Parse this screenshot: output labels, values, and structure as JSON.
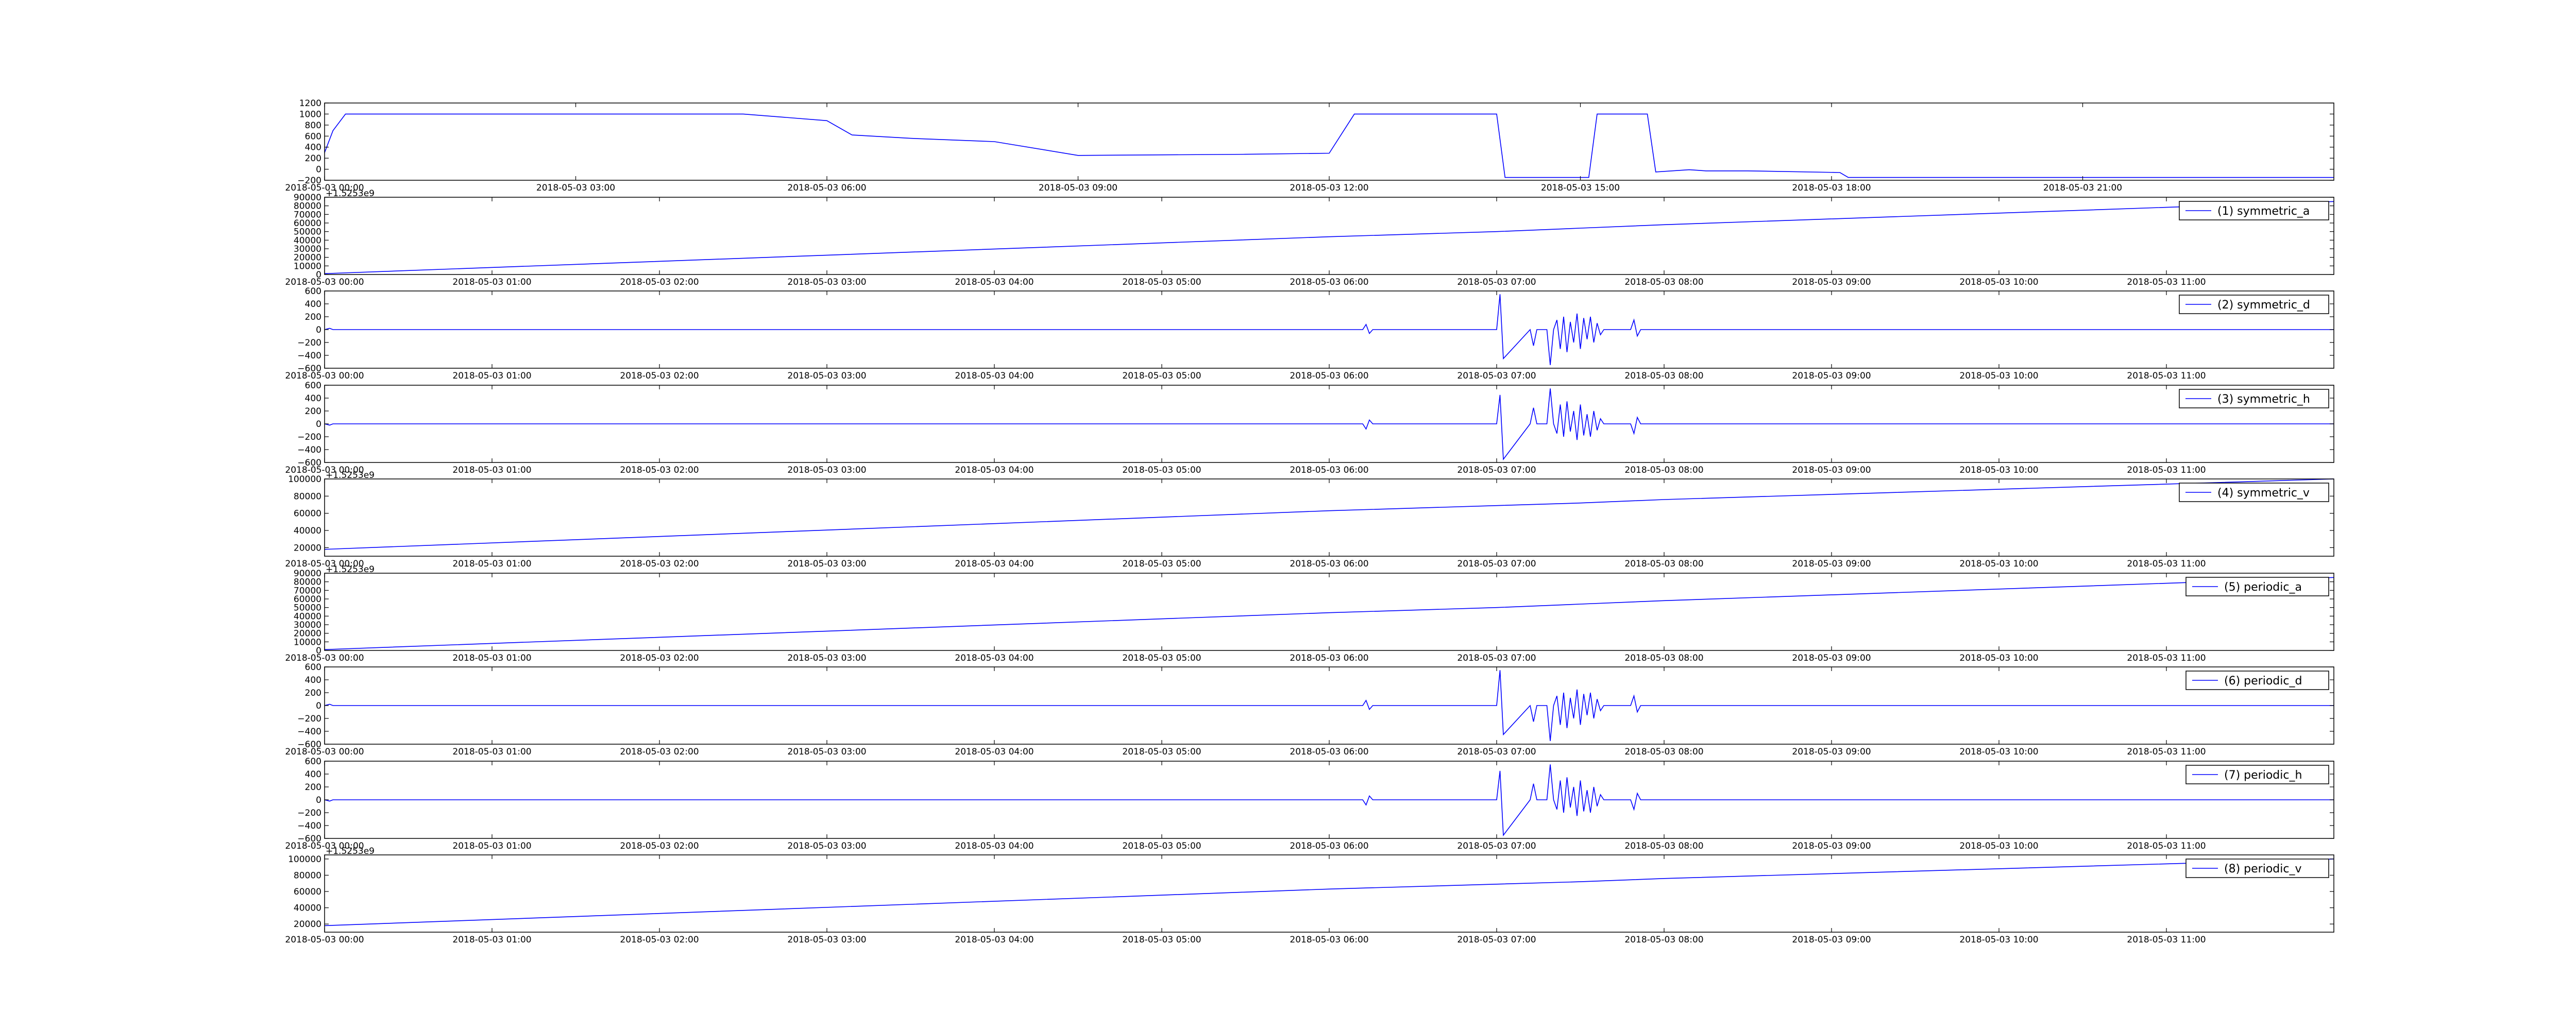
{
  "chart_data": [
    {
      "type": "line",
      "legend": "",
      "offset_text": "",
      "color": "#0000ff",
      "ylim": [
        -200,
        1200
      ],
      "yticks": [
        -200,
        0,
        200,
        400,
        600,
        800,
        1000,
        1200
      ],
      "xlim": [
        0,
        24
      ],
      "xticks": [
        0,
        3,
        6,
        9,
        12,
        15,
        18,
        21
      ],
      "xtick_labels": [
        "2018-05-03 00:00",
        "2018-05-03 03:00",
        "2018-05-03 06:00",
        "2018-05-03 09:00",
        "2018-05-03 12:00",
        "2018-05-03 15:00",
        "2018-05-03 18:00",
        "2018-05-03 21:00"
      ],
      "x": [
        0,
        0.1,
        0.25,
        3,
        5.0,
        6.0,
        6.3,
        7,
        8,
        9,
        10,
        11,
        12,
        12.3,
        13.4,
        14.0,
        14.1,
        15.1,
        15.2,
        15.8,
        15.9,
        16.3,
        16.5,
        17,
        18.1,
        18.2,
        24
      ],
      "values": [
        300,
        700,
        1000,
        1000,
        1000,
        880,
        620,
        560,
        500,
        250,
        260,
        270,
        290,
        1000,
        1000,
        1000,
        -150,
        -150,
        1000,
        1000,
        -50,
        -10,
        -30,
        -30,
        -60,
        -150,
        -150
      ]
    },
    {
      "type": "line",
      "legend": "(1) symmetric_a",
      "offset_text": "+1.5253e9",
      "color": "#0000ff",
      "ylim": [
        0,
        90000
      ],
      "yticks": [
        0,
        10000,
        20000,
        30000,
        40000,
        50000,
        60000,
        70000,
        80000,
        90000
      ],
      "xlim": [
        0,
        12
      ],
      "xticks": [
        0,
        1,
        2,
        3,
        4,
        5,
        6,
        7,
        8,
        9,
        10,
        11
      ],
      "xtick_labels": [
        "2018-05-03 00:00",
        "2018-05-03 01:00",
        "2018-05-03 02:00",
        "2018-05-03 03:00",
        "2018-05-03 04:00",
        "2018-05-03 05:00",
        "2018-05-03 06:00",
        "2018-05-03 07:00",
        "2018-05-03 08:00",
        "2018-05-03 09:00",
        "2018-05-03 10:00",
        "2018-05-03 11:00"
      ],
      "x": [
        0,
        6,
        7,
        7.5,
        8,
        12
      ],
      "values": [
        1000,
        44000,
        50000,
        54000,
        58000,
        85000
      ]
    },
    {
      "type": "line",
      "legend": "(2) symmetric_d",
      "offset_text": "",
      "color": "#0000ff",
      "ylim": [
        -600,
        600
      ],
      "yticks": [
        -600,
        -400,
        -200,
        0,
        200,
        400,
        600
      ],
      "xlim": [
        0,
        12
      ],
      "xticks": [
        0,
        1,
        2,
        3,
        4,
        5,
        6,
        7,
        8,
        9,
        10,
        11
      ],
      "xtick_labels": [
        "2018-05-03 00:00",
        "2018-05-03 01:00",
        "2018-05-03 02:00",
        "2018-05-03 03:00",
        "2018-05-03 04:00",
        "2018-05-03 05:00",
        "2018-05-03 06:00",
        "2018-05-03 07:00",
        "2018-05-03 08:00",
        "2018-05-03 09:00",
        "2018-05-03 10:00",
        "2018-05-03 11:00"
      ],
      "x": [
        0,
        0.03,
        0.05,
        5.8,
        6.2,
        6.22,
        6.24,
        6.26,
        7.0,
        7.02,
        7.04,
        7.2,
        7.22,
        7.24,
        7.26,
        7.3,
        7.32,
        7.34,
        7.36,
        7.38,
        7.4,
        7.42,
        7.44,
        7.46,
        7.48,
        7.5,
        7.52,
        7.54,
        7.56,
        7.58,
        7.6,
        7.62,
        7.64,
        7.8,
        7.82,
        7.84,
        7.86,
        8.1,
        12
      ],
      "values": [
        0,
        20,
        0,
        0,
        0,
        80,
        -60,
        0,
        0,
        550,
        -450,
        0,
        -250,
        0,
        0,
        0,
        -550,
        0,
        150,
        -300,
        200,
        -350,
        120,
        -200,
        250,
        -300,
        180,
        -150,
        200,
        -200,
        100,
        -80,
        0,
        0,
        150,
        -100,
        0,
        0,
        0
      ]
    },
    {
      "type": "line",
      "legend": "(3) symmetric_h",
      "offset_text": "",
      "color": "#0000ff",
      "ylim": [
        -600,
        600
      ],
      "yticks": [
        -600,
        -400,
        -200,
        0,
        200,
        400,
        600
      ],
      "xlim": [
        0,
        12
      ],
      "xticks": [
        0,
        1,
        2,
        3,
        4,
        5,
        6,
        7,
        8,
        9,
        10,
        11
      ],
      "xtick_labels": [
        "2018-05-03 00:00",
        "2018-05-03 01:00",
        "2018-05-03 02:00",
        "2018-05-03 03:00",
        "2018-05-03 04:00",
        "2018-05-03 05:00",
        "2018-05-03 06:00",
        "2018-05-03 07:00",
        "2018-05-03 08:00",
        "2018-05-03 09:00",
        "2018-05-03 10:00",
        "2018-05-03 11:00"
      ],
      "x": [
        0,
        0.03,
        0.05,
        5.8,
        6.2,
        6.22,
        6.24,
        6.26,
        7.0,
        7.02,
        7.04,
        7.2,
        7.22,
        7.24,
        7.26,
        7.3,
        7.32,
        7.34,
        7.36,
        7.38,
        7.4,
        7.42,
        7.44,
        7.46,
        7.48,
        7.5,
        7.52,
        7.54,
        7.56,
        7.58,
        7.6,
        7.62,
        7.64,
        7.8,
        7.82,
        7.84,
        7.86,
        8.1,
        12
      ],
      "values": [
        0,
        -20,
        0,
        0,
        0,
        -80,
        60,
        0,
        0,
        450,
        -550,
        0,
        250,
        0,
        0,
        0,
        550,
        0,
        -150,
        300,
        -200,
        350,
        -120,
        200,
        -250,
        300,
        -180,
        150,
        -200,
        200,
        -100,
        80,
        0,
        0,
        -150,
        100,
        0,
        0,
        0
      ]
    },
    {
      "type": "line",
      "legend": "(4) symmetric_v",
      "offset_text": "+1.5253e9",
      "color": "#0000ff",
      "ylim": [
        10000,
        100000
      ],
      "yticks": [
        20000,
        40000,
        60000,
        80000,
        100000
      ],
      "xlim": [
        0,
        12
      ],
      "xticks": [
        0,
        1,
        2,
        3,
        4,
        5,
        6,
        7,
        8,
        9,
        10,
        11
      ],
      "xtick_labels": [
        "2018-05-03 00:00",
        "2018-05-03 01:00",
        "2018-05-03 02:00",
        "2018-05-03 03:00",
        "2018-05-03 04:00",
        "2018-05-03 05:00",
        "2018-05-03 06:00",
        "2018-05-03 07:00",
        "2018-05-03 08:00",
        "2018-05-03 09:00",
        "2018-05-03 10:00",
        "2018-05-03 11:00"
      ],
      "x": [
        0,
        6,
        7,
        7.5,
        8,
        12
      ],
      "values": [
        18000,
        63000,
        69000,
        72000,
        76000,
        100000
      ]
    },
    {
      "type": "line",
      "legend": "(5) periodic_a",
      "offset_text": "+1.5253e9",
      "color": "#0000ff",
      "ylim": [
        0,
        90000
      ],
      "yticks": [
        0,
        10000,
        20000,
        30000,
        40000,
        50000,
        60000,
        70000,
        80000,
        90000
      ],
      "xlim": [
        0,
        12
      ],
      "xticks": [
        0,
        1,
        2,
        3,
        4,
        5,
        6,
        7,
        8,
        9,
        10,
        11
      ],
      "xtick_labels": [
        "2018-05-03 00:00",
        "2018-05-03 01:00",
        "2018-05-03 02:00",
        "2018-05-03 03:00",
        "2018-05-03 04:00",
        "2018-05-03 05:00",
        "2018-05-03 06:00",
        "2018-05-03 07:00",
        "2018-05-03 08:00",
        "2018-05-03 09:00",
        "2018-05-03 10:00",
        "2018-05-03 11:00"
      ],
      "x": [
        0,
        6,
        7,
        7.5,
        8,
        12
      ],
      "values": [
        1000,
        44000,
        50000,
        54000,
        58000,
        85000
      ]
    },
    {
      "type": "line",
      "legend": "(6) periodic_d",
      "offset_text": "",
      "color": "#0000ff",
      "ylim": [
        -600,
        600
      ],
      "yticks": [
        -600,
        -400,
        -200,
        0,
        200,
        400,
        600
      ],
      "xlim": [
        0,
        12
      ],
      "xticks": [
        0,
        1,
        2,
        3,
        4,
        5,
        6,
        7,
        8,
        9,
        10,
        11
      ],
      "xtick_labels": [
        "2018-05-03 00:00",
        "2018-05-03 01:00",
        "2018-05-03 02:00",
        "2018-05-03 03:00",
        "2018-05-03 04:00",
        "2018-05-03 05:00",
        "2018-05-03 06:00",
        "2018-05-03 07:00",
        "2018-05-03 08:00",
        "2018-05-03 09:00",
        "2018-05-03 10:00",
        "2018-05-03 11:00"
      ],
      "x": [
        0,
        0.03,
        0.05,
        5.8,
        6.2,
        6.22,
        6.24,
        6.26,
        7.0,
        7.02,
        7.04,
        7.2,
        7.22,
        7.24,
        7.26,
        7.3,
        7.32,
        7.34,
        7.36,
        7.38,
        7.4,
        7.42,
        7.44,
        7.46,
        7.48,
        7.5,
        7.52,
        7.54,
        7.56,
        7.58,
        7.6,
        7.62,
        7.64,
        7.8,
        7.82,
        7.84,
        7.86,
        8.1,
        12
      ],
      "values": [
        0,
        20,
        0,
        0,
        0,
        80,
        -60,
        0,
        0,
        550,
        -450,
        0,
        -250,
        0,
        0,
        0,
        -550,
        0,
        150,
        -300,
        200,
        -350,
        120,
        -200,
        250,
        -300,
        180,
        -150,
        200,
        -200,
        100,
        -80,
        0,
        0,
        150,
        -100,
        0,
        0,
        0
      ]
    },
    {
      "type": "line",
      "legend": "(7) periodic_h",
      "offset_text": "",
      "color": "#0000ff",
      "ylim": [
        -600,
        600
      ],
      "yticks": [
        -600,
        -400,
        -200,
        0,
        200,
        400,
        600
      ],
      "xlim": [
        0,
        12
      ],
      "xticks": [
        0,
        1,
        2,
        3,
        4,
        5,
        6,
        7,
        8,
        9,
        10,
        11
      ],
      "xtick_labels": [
        "2018-05-03 00:00",
        "2018-05-03 01:00",
        "2018-05-03 02:00",
        "2018-05-03 03:00",
        "2018-05-03 04:00",
        "2018-05-03 05:00",
        "2018-05-03 06:00",
        "2018-05-03 07:00",
        "2018-05-03 08:00",
        "2018-05-03 09:00",
        "2018-05-03 10:00",
        "2018-05-03 11:00"
      ],
      "x": [
        0,
        0.03,
        0.05,
        5.8,
        6.2,
        6.22,
        6.24,
        6.26,
        7.0,
        7.02,
        7.04,
        7.2,
        7.22,
        7.24,
        7.26,
        7.3,
        7.32,
        7.34,
        7.36,
        7.38,
        7.4,
        7.42,
        7.44,
        7.46,
        7.48,
        7.5,
        7.52,
        7.54,
        7.56,
        7.58,
        7.6,
        7.62,
        7.64,
        7.8,
        7.82,
        7.84,
        7.86,
        8.1,
        12
      ],
      "values": [
        0,
        -20,
        0,
        0,
        0,
        -80,
        60,
        0,
        0,
        450,
        -550,
        0,
        250,
        0,
        0,
        0,
        550,
        0,
        -150,
        300,
        -200,
        350,
        -120,
        200,
        -250,
        300,
        -180,
        150,
        -200,
        200,
        -100,
        80,
        0,
        0,
        -150,
        100,
        0,
        0,
        0
      ]
    },
    {
      "type": "line",
      "legend": "(8) periodic_v",
      "offset_text": "+1.5253e9",
      "color": "#0000ff",
      "ylim": [
        10000,
        105000
      ],
      "yticks": [
        20000,
        40000,
        60000,
        80000,
        100000
      ],
      "xlim": [
        0,
        12
      ],
      "xticks": [
        0,
        1,
        2,
        3,
        4,
        5,
        6,
        7,
        8,
        9,
        10,
        11
      ],
      "xtick_labels": [
        "2018-05-03 00:00",
        "2018-05-03 01:00",
        "2018-05-03 02:00",
        "2018-05-03 03:00",
        "2018-05-03 04:00",
        "2018-05-03 05:00",
        "2018-05-03 06:00",
        "2018-05-03 07:00",
        "2018-05-03 08:00",
        "2018-05-03 09:00",
        "2018-05-03 10:00",
        "2018-05-03 11:00"
      ],
      "x": [
        0,
        6,
        7,
        7.5,
        8,
        12
      ],
      "values": [
        18000,
        63000,
        69000,
        72000,
        76000,
        100000
      ]
    }
  ]
}
